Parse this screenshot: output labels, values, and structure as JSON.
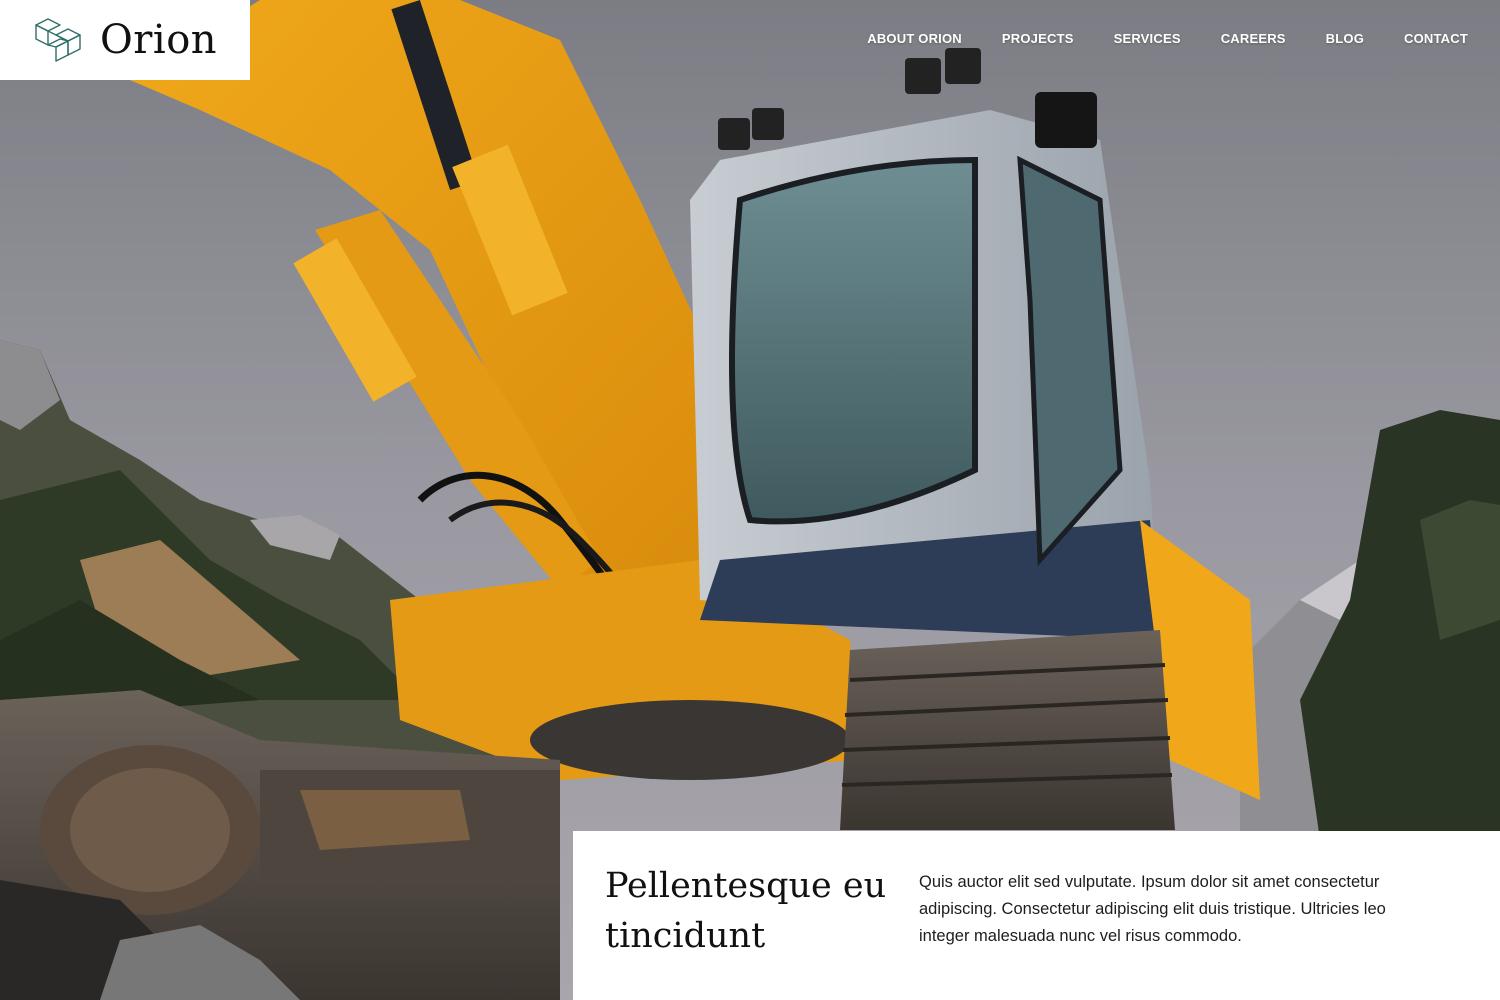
{
  "brand": {
    "name": "Orion",
    "logo_icon": "orion-geometric-logo-icon",
    "accent_color": "#2f6f6a"
  },
  "nav": {
    "items": [
      {
        "label": "ABOUT ORION"
      },
      {
        "label": "PROJECTS"
      },
      {
        "label": "SERVICES"
      },
      {
        "label": "CAREERS"
      },
      {
        "label": "BLOG"
      },
      {
        "label": "CONTACT"
      }
    ]
  },
  "hero": {
    "image": "excavator-in-mountains-photo"
  },
  "feature": {
    "title_line1": "Pellentesque eu",
    "title_line2": "tincidunt",
    "body": "Quis auctor elit sed vulputate. Ipsum dolor sit amet consectetur adipiscing. Consectetur adipiscing elit duis tristique. Ultricies leo integer malesuada nunc vel risus commodo."
  }
}
